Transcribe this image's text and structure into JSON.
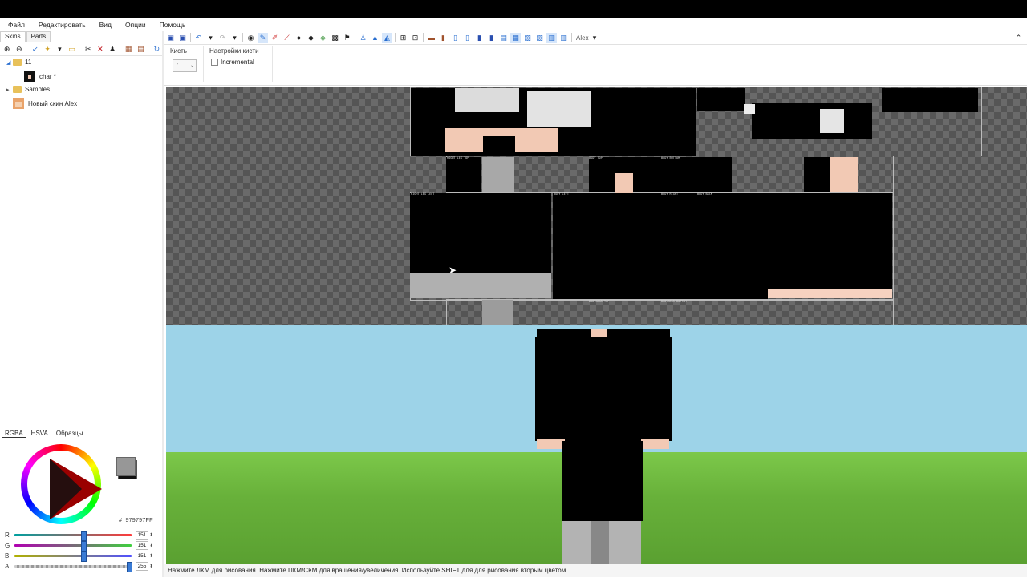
{
  "menu": {
    "items": [
      "Файл",
      "Редактировать",
      "Вид",
      "Опции",
      "Помощь"
    ]
  },
  "sidebar": {
    "tabs": [
      "Skins",
      "Parts"
    ],
    "tree": {
      "folder_name": "11",
      "skin_char": "char *",
      "samples": "Samples",
      "new_skin": "Новый скин Alex"
    }
  },
  "color_panel": {
    "tabs": [
      "RGBA",
      "HSVA",
      "Образцы"
    ],
    "hex": "979797FF",
    "hex_prefix": "#",
    "primary_color": "#979797",
    "secondary_color": "#000000",
    "channels": [
      {
        "label": "R",
        "value": "151",
        "fraction": 0.59
      },
      {
        "label": "G",
        "value": "151",
        "fraction": 0.59
      },
      {
        "label": "B",
        "value": "151",
        "fraction": 0.59
      },
      {
        "label": "A",
        "value": "255",
        "fraction": 1.0
      }
    ]
  },
  "toolbar": {
    "model_select": "Alex"
  },
  "brush_options": {
    "brush_group_title": "Кисть",
    "brush_value": "-",
    "settings_group_title": "Настройки кисти",
    "incremental_label": "Incremental"
  },
  "status_bar": {
    "text": "Нажмите ЛКМ для рисования. Нажмите ПКМ/СКМ для вращения/увеличения. Используйте SHIFT для для рисования вторым цветом."
  },
  "colors": {
    "sky": "#9dd3e8",
    "grass": "#68b13a",
    "skin": "#f2c9b4",
    "accent": "#3a7bd5"
  }
}
